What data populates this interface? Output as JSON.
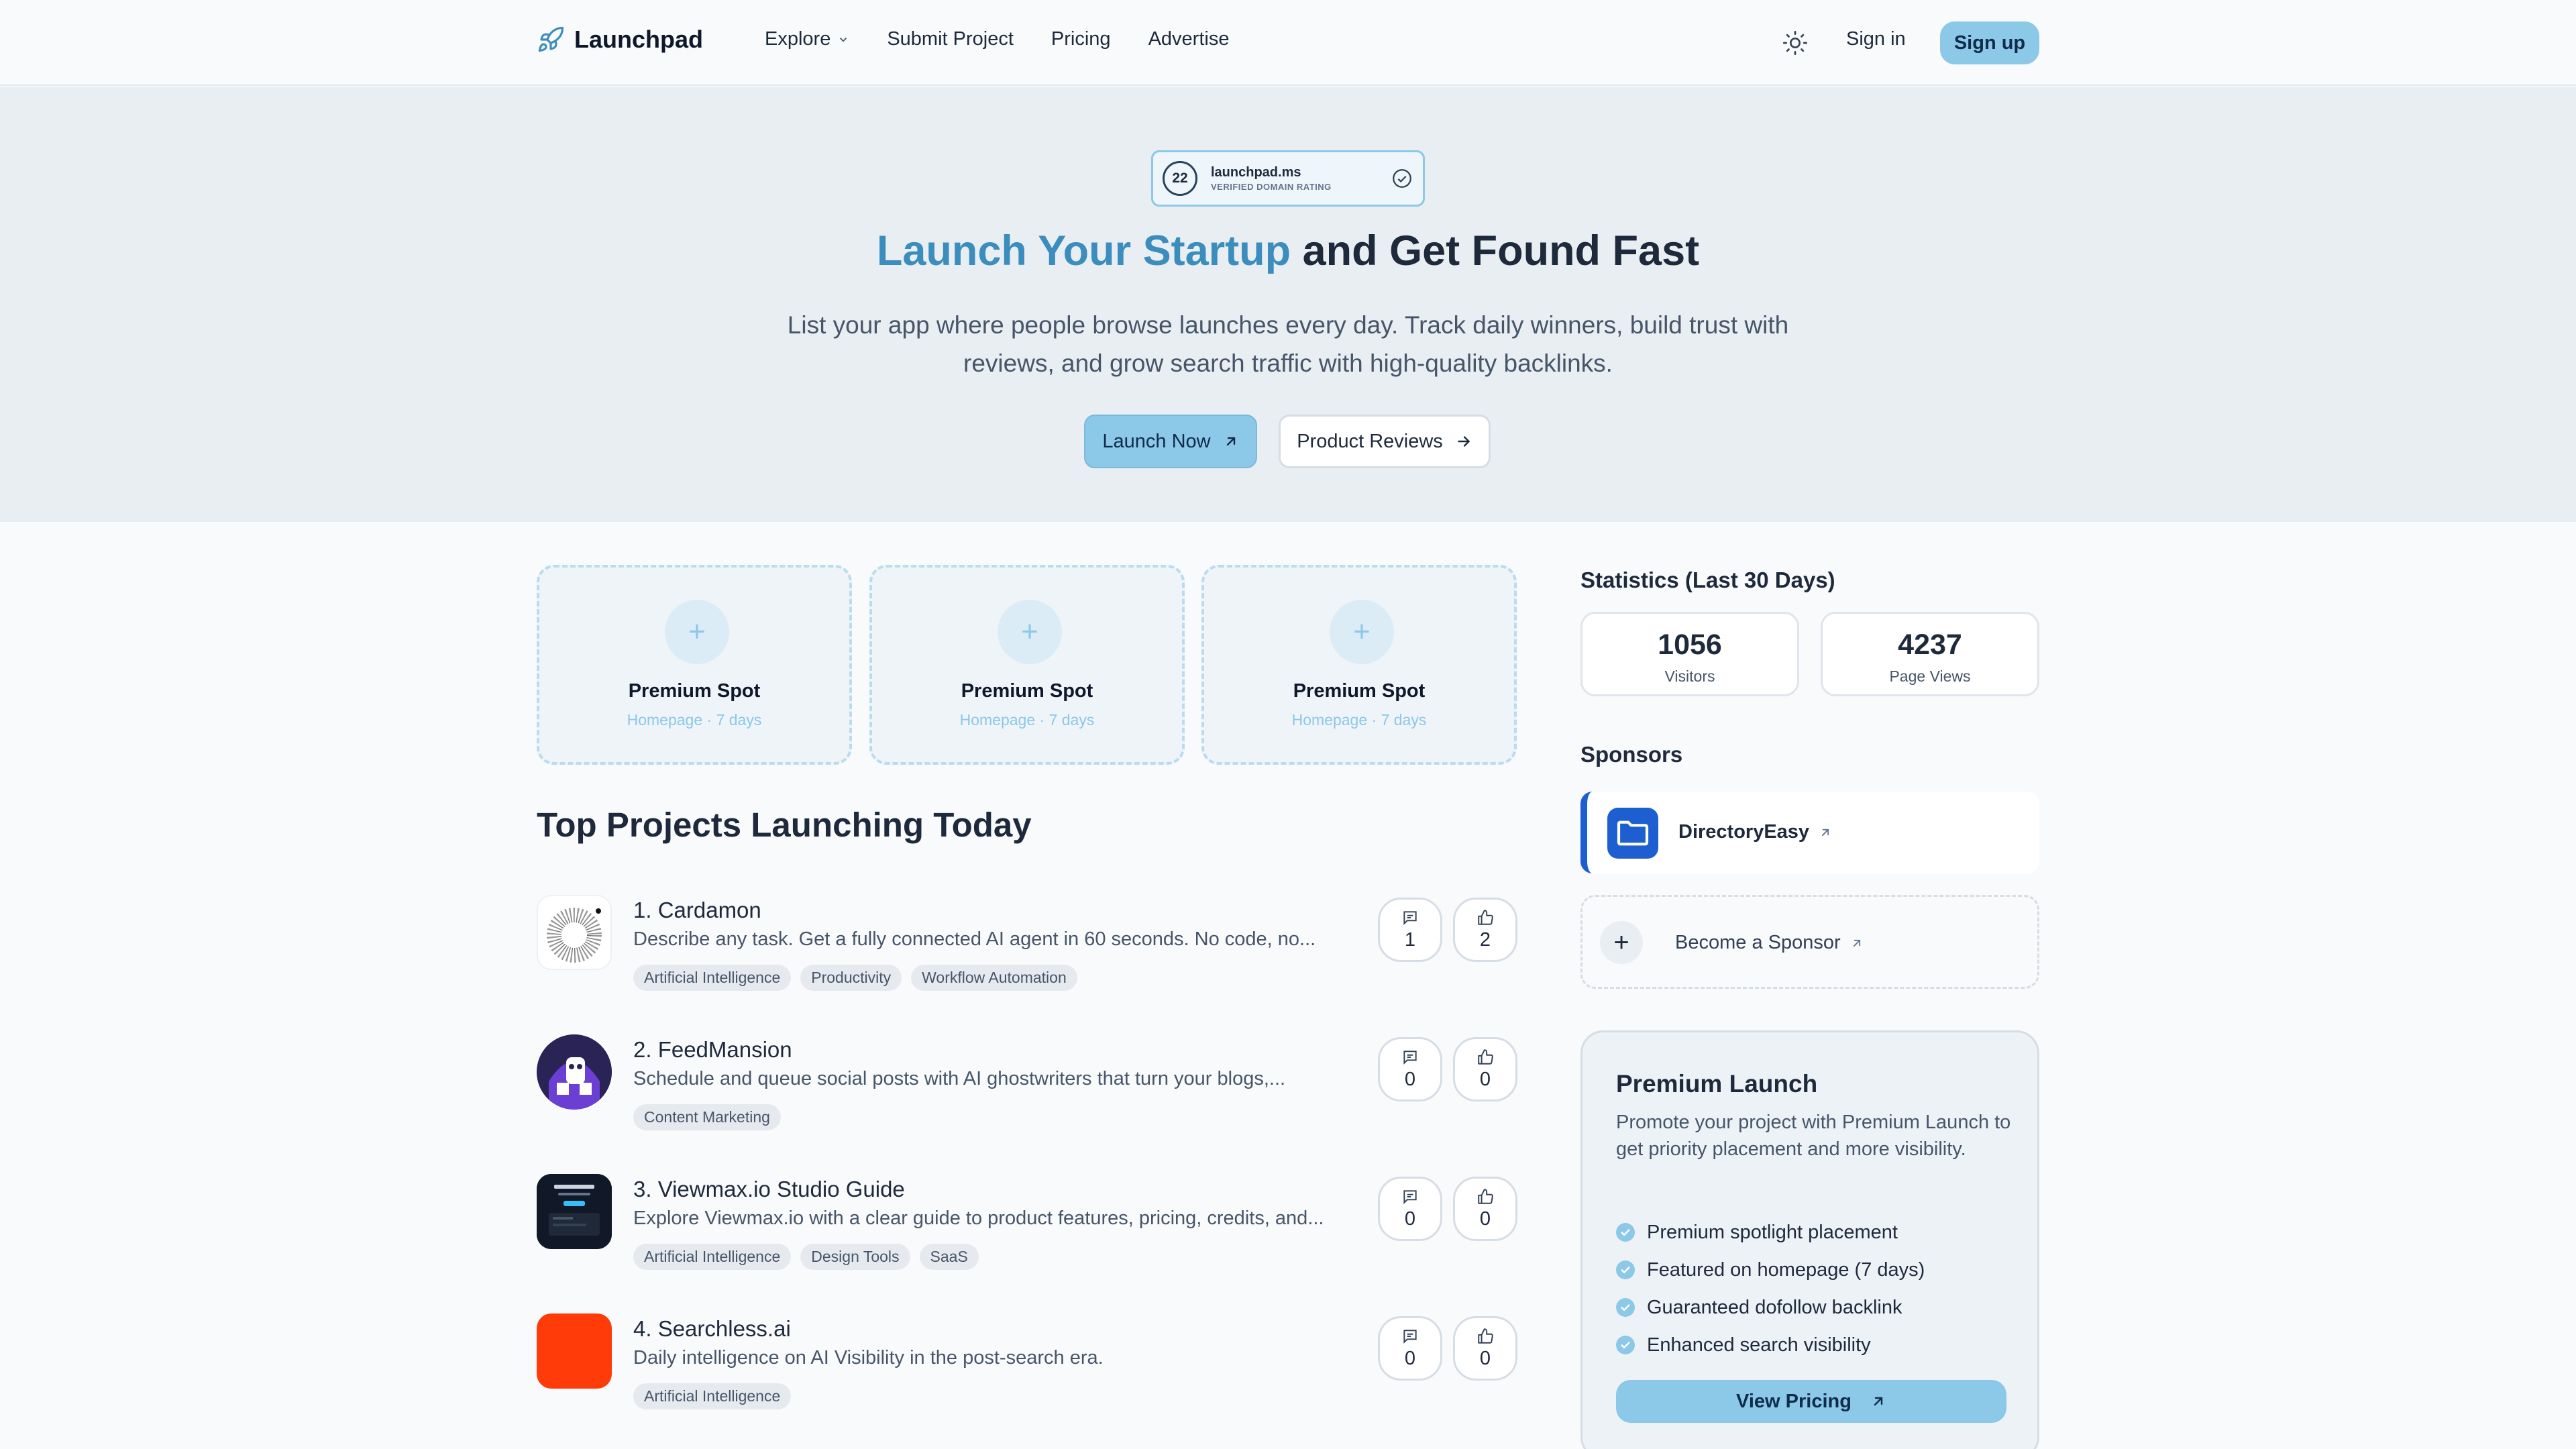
{
  "header": {
    "logo_text": "Launchpad",
    "logo_icon": "rocket-icon",
    "nav": [
      {
        "label": "Explore",
        "has_dropdown": true
      },
      {
        "label": "Submit Project"
      },
      {
        "label": "Pricing"
      },
      {
        "label": "Advertise"
      }
    ],
    "theme_icon": "sun-icon",
    "sign_in": "Sign in",
    "sign_up": "Sign up"
  },
  "hero": {
    "badge": {
      "rating": "22",
      "domain": "launchpad.ms",
      "label": "VERIFIED DOMAIN RATING",
      "icon": "check-circle-icon"
    },
    "title_accent": "Launch Your Startup",
    "title_rest": " and Get Found Fast",
    "subtitle": "List your app where people browse launches every day. Track daily winners, build trust with reviews, and grow search traffic with high-quality backlinks.",
    "primary_cta": "Launch Now",
    "secondary_cta": "Product Reviews"
  },
  "premium_spots": [
    {
      "title": "Premium Spot",
      "sub": "Homepage · 7 days"
    },
    {
      "title": "Premium Spot",
      "sub": "Homepage · 7 days"
    },
    {
      "title": "Premium Spot",
      "sub": "Homepage · 7 days"
    }
  ],
  "projects": {
    "title": "Top Projects Launching Today",
    "items": [
      {
        "name": "1. Cardamon",
        "desc": "Describe any task. Get a fully connected AI agent in 60 seconds. No code, no...",
        "tags": [
          "Artificial Intelligence",
          "Productivity",
          "Workflow Automation"
        ],
        "comments": "1",
        "upvotes": "2"
      },
      {
        "name": "2. FeedMansion",
        "desc": "Schedule and queue social posts with AI ghostwriters that turn your blogs,...",
        "tags": [
          "Content Marketing"
        ],
        "comments": "0",
        "upvotes": "0"
      },
      {
        "name": "3. Viewmax.io Studio Guide",
        "desc": "Explore Viewmax.io with a clear guide to product features, pricing, credits, and...",
        "tags": [
          "Artificial Intelligence",
          "Design Tools",
          "SaaS"
        ],
        "comments": "0",
        "upvotes": "0"
      },
      {
        "name": "4. Searchless.ai",
        "desc": "Daily intelligence on AI Visibility in the post-search era.",
        "tags": [
          "Artificial Intelligence"
        ],
        "comments": "0",
        "upvotes": "0"
      }
    ]
  },
  "sidebar": {
    "stats_title": "Statistics (Last 30 Days)",
    "stats": [
      {
        "value": "1056",
        "label": "Visitors"
      },
      {
        "value": "4237",
        "label": "Page Views"
      }
    ],
    "sponsors_title": "Sponsors",
    "sponsor": {
      "name": "DirectoryEasy",
      "icon": "folder-icon"
    },
    "become_sponsor": "Become a Sponsor",
    "premium": {
      "title": "Premium Launch",
      "desc": "Promote your project with Premium Launch to get priority placement and more visibility.",
      "features": [
        "Premium spotlight placement",
        "Featured on homepage (7 days)",
        "Guaranteed dofollow backlink",
        "Enhanced search visibility"
      ],
      "cta": "View Pricing"
    }
  },
  "colors": {
    "accent": "#8cc8e8",
    "accent_text": "#3b8dbd",
    "sponsor_blue": "#1d5fd1",
    "searchless_red": "#ff3b0a"
  }
}
